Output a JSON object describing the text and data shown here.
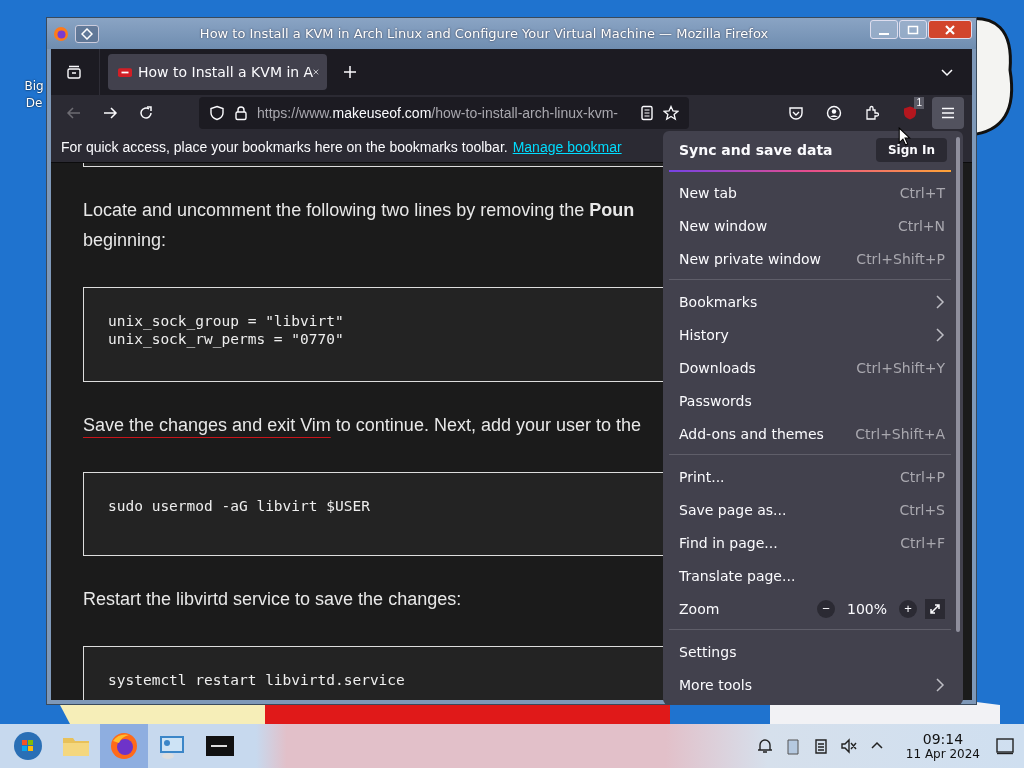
{
  "desktop_icon": {
    "label": "Big De"
  },
  "window": {
    "title": "How to Install a KVM in Arch Linux and Configure Your Virtual Machine — Mozilla Firefox"
  },
  "tabs": [
    {
      "title": "How to Install a KVM in A",
      "selected": true
    }
  ],
  "nav_buttons": [
    {
      "kind": "back",
      "disabled": true
    },
    {
      "kind": "forward",
      "disabled": false
    },
    {
      "kind": "reload",
      "disabled": false
    }
  ],
  "url": {
    "prefix": "https://www.",
    "domain": "makeuseof.com",
    "path": "/how-to-install-arch-linux-kvm-"
  },
  "toolbar_buttons": [
    {
      "kind": "pocket",
      "pressed": false
    },
    {
      "kind": "account",
      "pressed": false
    },
    {
      "kind": "extensions",
      "pressed": false
    },
    {
      "kind": "shield",
      "pressed": false,
      "badge": "1"
    },
    {
      "kind": "menu",
      "pressed": true
    }
  ],
  "bookmarks_bar": {
    "message": "For quick access, place your bookmarks here on the bookmarks toolbar.",
    "link": "Manage bookmar"
  },
  "content": [
    {
      "kind": "paragraph",
      "lines": [
        "Locate and uncomment the following two lines by removing the **Poun**",
        "beginning:"
      ]
    },
    {
      "kind": "code",
      "lines": [
        "unix_sock_group = \"libvirt\"",
        "unix_sock_rw_perms = \"0770\""
      ]
    },
    {
      "kind": "paragraph",
      "link": "Save the changes and exit Vim",
      "lines": [
        " to continue. Next, add your user to the"
      ]
    },
    {
      "kind": "code",
      "lines": [
        "sudo usermod -aG libvirt $USER"
      ]
    },
    {
      "kind": "paragraph",
      "lines": [
        "Restart the libvirtd service to save the changes:"
      ]
    },
    {
      "kind": "code",
      "lines": [
        "systemctl restart libvirtd.service"
      ]
    }
  ],
  "menu": {
    "header": "Sync and save data",
    "sign_in": "Sign In",
    "items": [
      {
        "kind": "item",
        "label": "New tab",
        "shortcut": "Ctrl+T"
      },
      {
        "kind": "item",
        "label": "New window",
        "shortcut": "Ctrl+N"
      },
      {
        "kind": "item",
        "label": "New private window",
        "shortcut": "Ctrl+Shift+P"
      },
      {
        "kind": "separator"
      },
      {
        "kind": "submenu",
        "label": "Bookmarks"
      },
      {
        "kind": "submenu",
        "label": "History"
      },
      {
        "kind": "item",
        "label": "Downloads",
        "shortcut": "Ctrl+Shift+Y"
      },
      {
        "kind": "item",
        "label": "Passwords"
      },
      {
        "kind": "item",
        "label": "Add-ons and themes",
        "shortcut": "Ctrl+Shift+A"
      },
      {
        "kind": "separator"
      },
      {
        "kind": "item",
        "label": "Print...",
        "shortcut": "Ctrl+P"
      },
      {
        "kind": "item",
        "label": "Save page as...",
        "shortcut": "Ctrl+S"
      },
      {
        "kind": "item",
        "label": "Find in page...",
        "shortcut": "Ctrl+F"
      },
      {
        "kind": "item",
        "label": "Translate page..."
      },
      {
        "kind": "zoom",
        "label": "Zoom",
        "minus": "−",
        "value": "100%",
        "plus": "+"
      },
      {
        "kind": "separator"
      },
      {
        "kind": "item",
        "label": "Settings"
      },
      {
        "kind": "submenu",
        "label": "More tools"
      }
    ]
  },
  "taskbar": {
    "apps": [
      {
        "kind": "start",
        "active": false
      },
      {
        "kind": "files",
        "active": false
      },
      {
        "kind": "firefox",
        "active": true
      },
      {
        "kind": "control",
        "active": false
      },
      {
        "kind": "terminal",
        "active": false
      }
    ],
    "tray": [
      {
        "kind": "bell"
      },
      {
        "kind": "clipboard"
      },
      {
        "kind": "notes"
      },
      {
        "kind": "muted"
      },
      {
        "kind": "chevron"
      }
    ],
    "time": "09:14",
    "date": "11 Apr 2024"
  }
}
